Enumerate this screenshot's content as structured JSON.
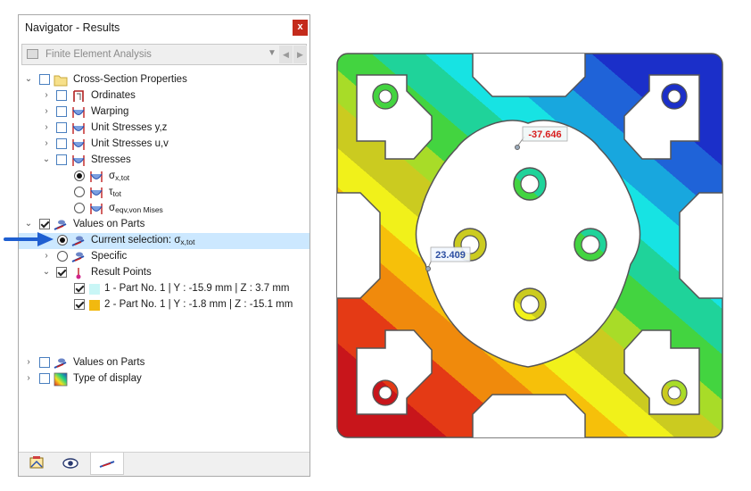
{
  "window": {
    "title": "Navigator - Results",
    "close_label": "x"
  },
  "combo": {
    "value": "Finite Element Analysis",
    "prev": "◀",
    "next": "▶"
  },
  "tree": {
    "cross_section": "Cross-Section Properties",
    "ordinates": "Ordinates",
    "warping": "Warping",
    "unit_stresses_yz": "Unit Stresses y,z",
    "unit_stresses_uv": "Unit Stresses u,v",
    "stresses": "Stresses",
    "sigma_xtot": {
      "main": "σ",
      "sub": "x,tot"
    },
    "tau_tot": {
      "main": "τ",
      "sub": "tot"
    },
    "sigma_mises": {
      "main": "σ",
      "sub": "eqv,von Mises"
    },
    "values_on_parts": "Values on Parts",
    "current_selection": {
      "main": "Current selection: σ",
      "sub": "x,tot"
    },
    "specific": "Specific",
    "result_points": "Result Points",
    "point1": "1 - Part No. 1 | Y : -15.9 mm | Z : 3.7 mm",
    "point2": "2 - Part No. 1 | Y : -1.8 mm | Z : -15.1 mm",
    "values_on_parts_2": "Values on Parts",
    "type_of_display": "Type of display"
  },
  "point_colors": {
    "p1": "#c9f6f6",
    "p2": "#f2b90f"
  },
  "labels": {
    "top_value": "-37.646",
    "left_value": "23.409"
  },
  "colors": {
    "top_label_text": "#d81e1e",
    "left_label_text": "#2b4ea1",
    "selection": "#cce8ff",
    "arrow": "#1f5fd1"
  }
}
